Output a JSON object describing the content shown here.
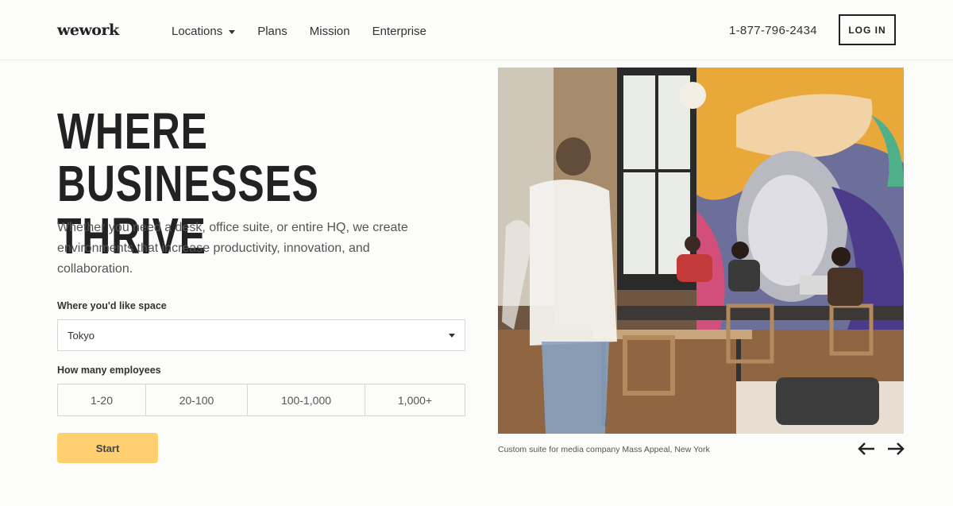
{
  "header": {
    "logo": "wework",
    "nav": [
      {
        "label": "Locations",
        "has_dropdown": true
      },
      {
        "label": "Plans"
      },
      {
        "label": "Mission"
      },
      {
        "label": "Enterprise"
      }
    ],
    "phone": "1-877-796-2434",
    "login_label": "LOG IN"
  },
  "hero": {
    "headline_line1": "WHERE BUSINESSES",
    "headline_line2": "THRIVE",
    "lead": "Whether you need a desk, office suite, or entire HQ, we create environments that increase productivity, innovation, and collaboration.",
    "location_label": "Where you'd like space",
    "location_value": "Tokyo",
    "employees_label": "How many employees",
    "employee_options": [
      "1-20",
      "20-100",
      "100-1,000",
      "1,000+"
    ],
    "start_label": "Start"
  },
  "photo": {
    "caption": "Custom suite for media company Mass Appeal, New York"
  },
  "carousel": {
    "prev_icon": "arrow-left-icon",
    "next_icon": "arrow-right-icon"
  },
  "colors": {
    "accent": "#ffce6e",
    "text": "#222222",
    "background": "#fcfcfa"
  }
}
